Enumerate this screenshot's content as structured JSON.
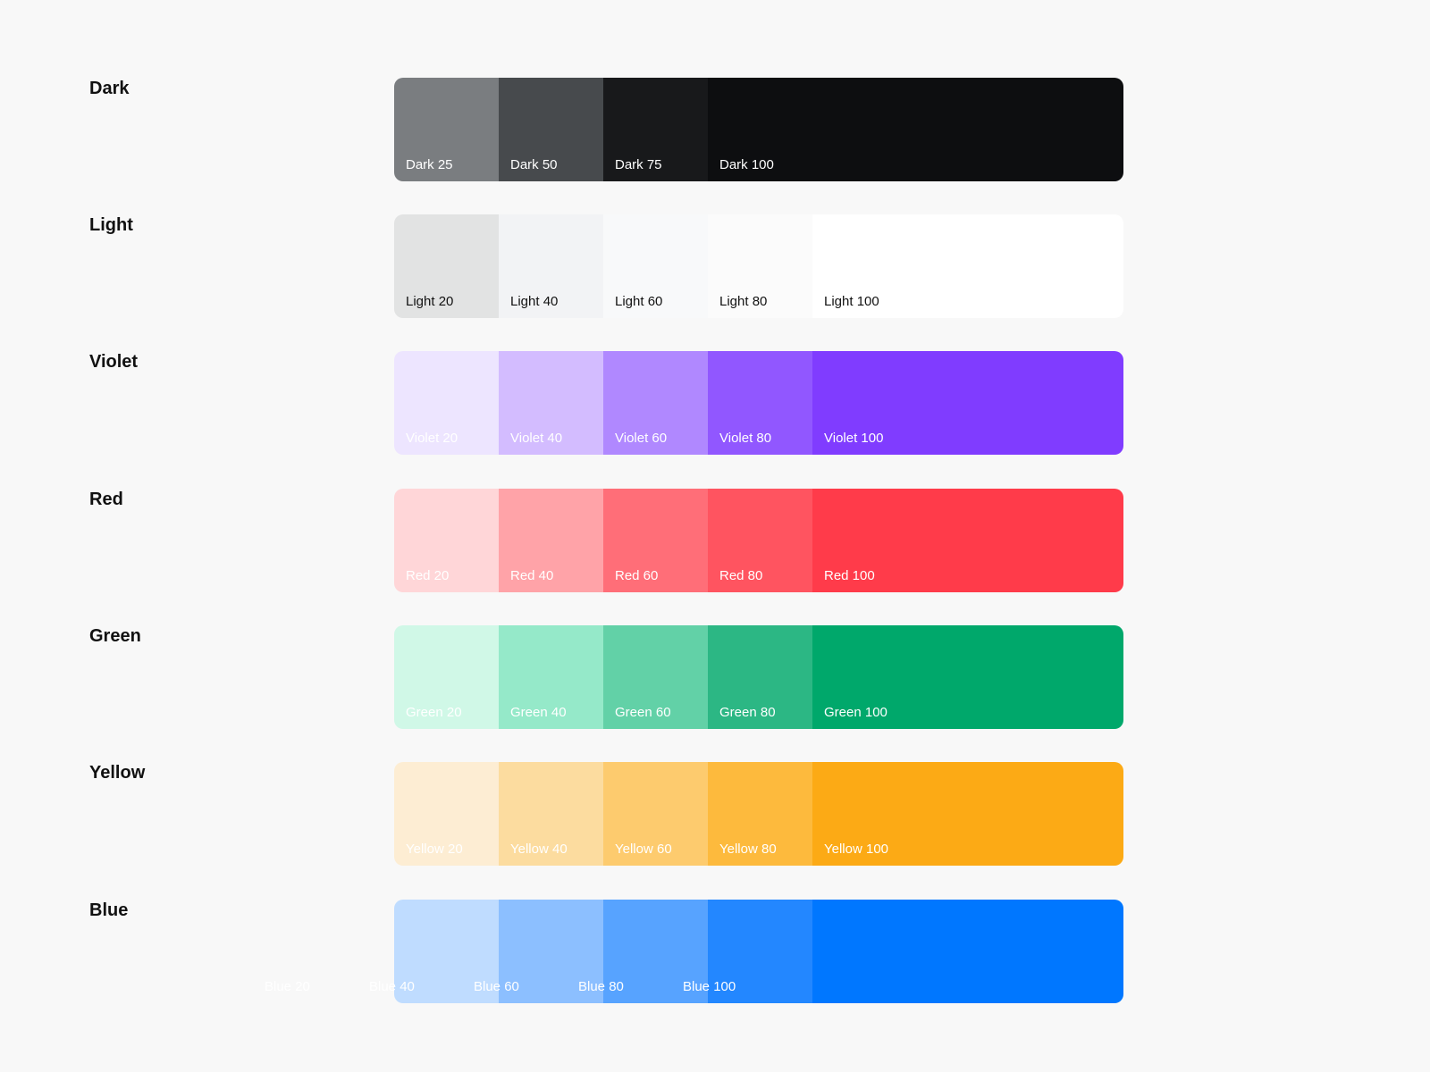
{
  "palettes": [
    {
      "name": "Dark",
      "swatches": [
        {
          "label": "Dark 25",
          "color": "#7a7d80",
          "text": "#ffffff"
        },
        {
          "label": "Dark 50",
          "color": "#474a4d",
          "text": "#ffffff"
        },
        {
          "label": "Dark 75",
          "color": "#18191b",
          "text": "#ffffff"
        },
        {
          "label": "Dark 100",
          "color": "#0d0e10",
          "text": "#ffffff"
        }
      ]
    },
    {
      "name": "Light",
      "swatches": [
        {
          "label": "Light 20",
          "color": "#e2e3e3",
          "text": "#111111"
        },
        {
          "label": "Light 40",
          "color": "#f2f3f5",
          "text": "#111111"
        },
        {
          "label": "Light 60",
          "color": "#f8f9fa",
          "text": "#111111"
        },
        {
          "label": "Light 80",
          "color": "#fbfbfb",
          "text": "#111111"
        },
        {
          "label": "Light 100",
          "color": "#ffffff",
          "text": "#111111"
        }
      ]
    },
    {
      "name": "Violet",
      "swatches": [
        {
          "label": "Violet 20",
          "color": "#ede5ff",
          "text": "#ffffff"
        },
        {
          "label": "Violet 40",
          "color": "#d3bcff",
          "text": "#ffffff"
        },
        {
          "label": "Violet 60",
          "color": "#b088ff",
          "text": "#ffffff"
        },
        {
          "label": "Violet 80",
          "color": "#9157ff",
          "text": "#ffffff"
        },
        {
          "label": "Violet 100",
          "color": "#803cff",
          "text": "#ffffff"
        }
      ]
    },
    {
      "name": "Red",
      "swatches": [
        {
          "label": "Red 20",
          "color": "#ffd6d8",
          "text": "#ffffff"
        },
        {
          "label": "Red 40",
          "color": "#ffa3a8",
          "text": "#ffffff"
        },
        {
          "label": "Red 60",
          "color": "#ff6e78",
          "text": "#ffffff"
        },
        {
          "label": "Red 80",
          "color": "#ff5460",
          "text": "#ffffff"
        },
        {
          "label": "Red 100",
          "color": "#ff3b4a",
          "text": "#ffffff"
        }
      ]
    },
    {
      "name": "Green",
      "swatches": [
        {
          "label": "Green 20",
          "color": "#d0f8e7",
          "text": "#ffffff"
        },
        {
          "label": "Green 40",
          "color": "#95e9c9",
          "text": "#ffffff"
        },
        {
          "label": "Green 60",
          "color": "#62d1a7",
          "text": "#ffffff"
        },
        {
          "label": "Green 80",
          "color": "#2cb784",
          "text": "#ffffff"
        },
        {
          "label": "Green 100",
          "color": "#00a86b",
          "text": "#ffffff"
        }
      ]
    },
    {
      "name": "Yellow",
      "swatches": [
        {
          "label": "Yellow 20",
          "color": "#fdedd3",
          "text": "#ffffff"
        },
        {
          "label": "Yellow 40",
          "color": "#fcdc9f",
          "text": "#ffffff"
        },
        {
          "label": "Yellow 60",
          "color": "#fdcb6e",
          "text": "#ffffff"
        },
        {
          "label": "Yellow 80",
          "color": "#fdba3d",
          "text": "#ffffff"
        },
        {
          "label": "Yellow 100",
          "color": "#fcaa15",
          "text": "#ffffff"
        }
      ]
    },
    {
      "name": "Blue",
      "swatches": [
        {
          "label": "Blue 20",
          "color": "#bfdcff",
          "text": "#ffffff"
        },
        {
          "label": "Blue 40",
          "color": "#8cbfff",
          "text": "#ffffff"
        },
        {
          "label": "Blue 60",
          "color": "#57a3ff",
          "text": "#ffffff"
        },
        {
          "label": "Blue 80",
          "color": "#2387ff",
          "text": "#ffffff"
        },
        {
          "label": "Blue 100",
          "color": "#0077ff",
          "text": "#ffffff"
        }
      ]
    }
  ]
}
